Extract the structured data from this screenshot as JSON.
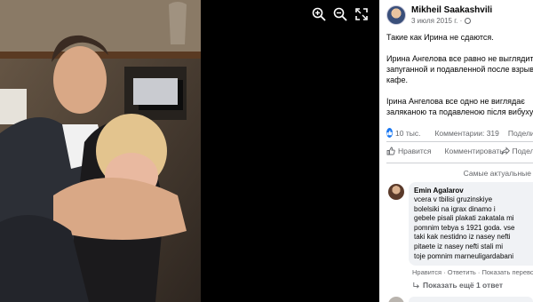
{
  "viewer": {
    "icons": [
      "zoom-in-icon",
      "zoom-out-icon",
      "fullscreen-icon"
    ],
    "background": "#000000"
  },
  "post": {
    "author": "Mikheil Saakashvili",
    "date": "3 июля 2015 г. ·",
    "text": [
      "Такие как Ирина не сдаются.",
      "",
      "Ирина Ангелова все равно не выглядит",
      "запуганной и подавленной после взрыва",
      "кафе.",
      "",
      "Ірина Ангелова все одно не виглядає",
      "заляканою та подавленою після вибуху в"
    ],
    "likes": "10 тыс.",
    "comments": "Комментарии: 319",
    "shares": "Поделиться",
    "like_label": "Нравится",
    "comment_label": "Комментировать",
    "share_label": "Поделиться",
    "sort_label": "Самые актуальные",
    "accent": "#1877f2"
  },
  "comment": {
    "author": "Emin Agalarov",
    "lines": [
      "vcera v tbilisi gruzinskiye",
      "bolelsiki na igrax dinamo i",
      "gebele pisali plakati zakatala mi",
      "pomnim tebya s 1921 goda. vse",
      "taki kak nestidno iz nasey nefti",
      "pitaete iz nasey nefti stali mi",
      "toje pomnim marneuligardabani"
    ],
    "actions": "Нравится · Ответить · Показать перевод",
    "replies": "Показать ещё 1 ответ"
  }
}
